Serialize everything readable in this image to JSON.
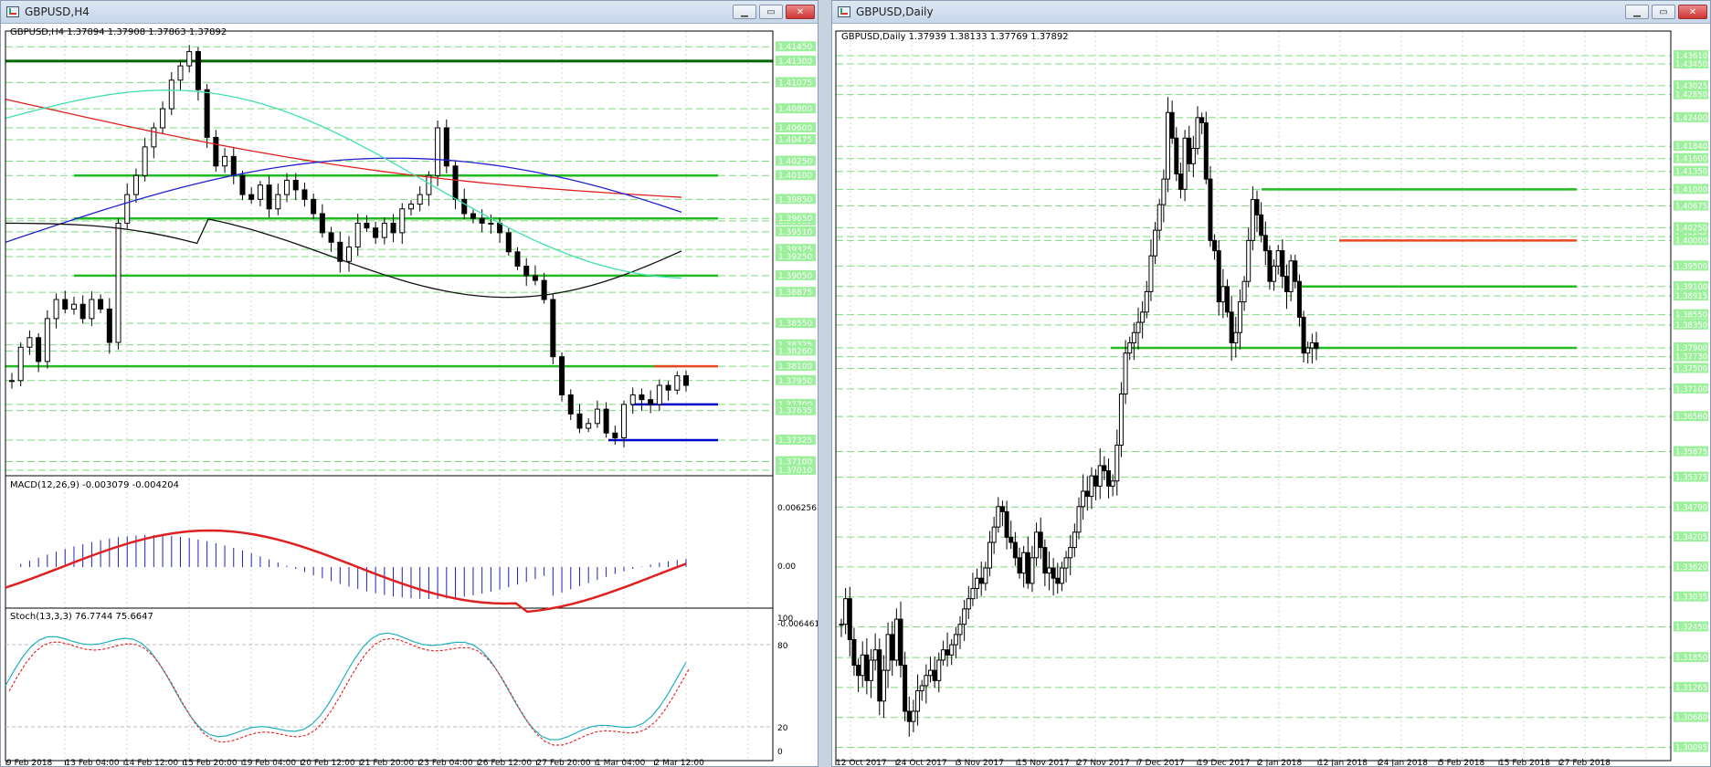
{
  "windows": {
    "h4": {
      "title": "GBPUSD,H4",
      "info": "GBPUSD,H4  1.37894 1.37908 1.37863 1.37892",
      "price_labels": [
        "1.41450",
        "1.41300",
        "1.41075",
        "1.40800",
        "1.40600",
        "1.40475",
        "1.40250",
        "1.40100",
        "1.39850",
        "1.39625",
        "1.39650",
        "1.39510",
        "1.39325",
        "1.39250",
        "1.39050",
        "1.38875",
        "1.38550",
        "1.38325",
        "1.38260",
        "1.38100",
        "1.37950",
        "1.37700",
        "1.37635",
        "1.37325",
        "1.37100",
        "1.37010"
      ],
      "macd_label": "MACD(12,26,9) -0.003079 -0.004204",
      "macd_scale": [
        "0.006256",
        "0.00",
        "-0.006461"
      ],
      "stoch_label": "Stoch(13,3,3) 76.7744 75.6647",
      "stoch_scale": [
        "100",
        "80",
        "20",
        "0"
      ],
      "time_labels": [
        "9 Feb 2018",
        "13 Feb 04:00",
        "14 Feb 12:00",
        "15 Feb 20:00",
        "19 Feb 04:00",
        "20 Feb 12:00",
        "21 Feb 20:00",
        "23 Feb 04:00",
        "26 Feb 12:00",
        "27 Feb 20:00",
        "1 Mar 04:00",
        "2 Mar 12:00"
      ]
    },
    "daily": {
      "title": "GBPUSD,Daily",
      "info": "GBPUSD,Daily  1.37939 1.38133 1.37769 1.37892",
      "price_labels": [
        "1.43610",
        "1.43450",
        "1.43025",
        "1.42850",
        "1.42400",
        "1.41840",
        "1.41600",
        "1.41350",
        "1.41000",
        "1.40675",
        "1.40250",
        "1.40075",
        "1.40000",
        "1.39500",
        "1.39100",
        "1.38915",
        "1.38550",
        "1.38350",
        "1.37900",
        "1.37730",
        "1.37500",
        "1.37100",
        "1.36560",
        "1.35875",
        "1.35375",
        "1.34790",
        "1.34205",
        "1.33620",
        "1.33035",
        "1.32450",
        "1.31850",
        "1.31265",
        "1.30680",
        "1.30095"
      ],
      "time_labels": [
        "12 Oct 2017",
        "24 Oct 2017",
        "3 Nov 2017",
        "15 Nov 2017",
        "27 Nov 2017",
        "7 Dec 2017",
        "19 Dec 2017",
        "2 Jan 2018",
        "12 Jan 2018",
        "24 Jan 2018",
        "5 Feb 2018",
        "15 Feb 2018",
        "27 Feb 2018"
      ]
    }
  },
  "colors": {
    "level_line": "#22bb22",
    "level_dash": "#7ddb7d",
    "resistance_top": "#006600",
    "red_level": "#e8491e",
    "blue_level": "#0000cc",
    "label_bg": "#9cf09c",
    "ma_red": "#e02020",
    "ma_blue": "#2020d0",
    "ma_black": "#111111",
    "ma_aqua": "#40e0b0"
  },
  "window_buttons": {
    "min": "▁",
    "max": "▭",
    "close": "✕"
  }
}
